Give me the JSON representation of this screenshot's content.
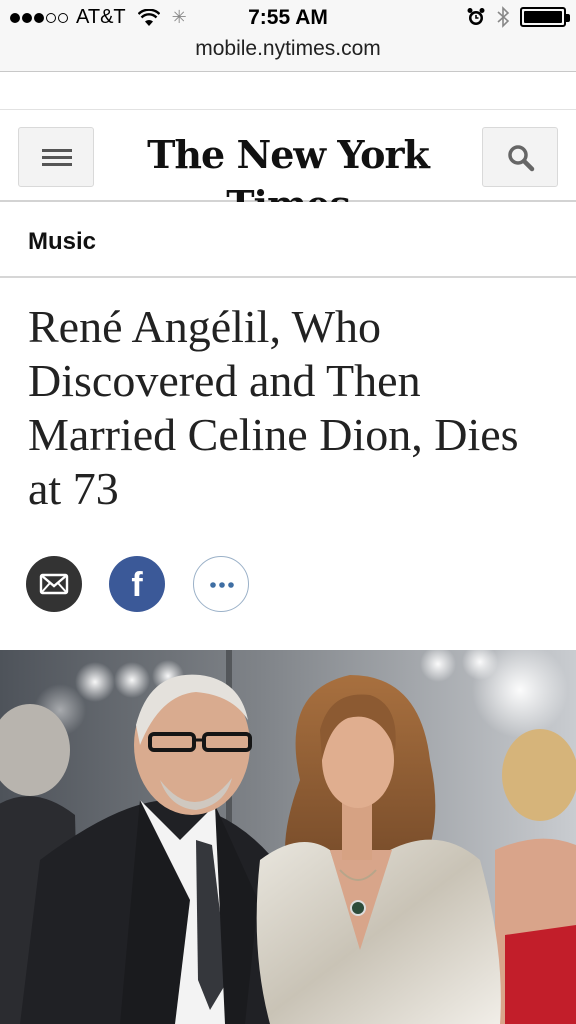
{
  "status_bar": {
    "carrier": "AT&T",
    "time": "7:55 AM",
    "signal_bars_filled": 3,
    "signal_bars_total": 5,
    "battery_level": 1.0
  },
  "browser": {
    "url": "mobile.nytimes.com"
  },
  "header": {
    "logo_text": "The New York Times",
    "menu_icon": "hamburger-menu-icon",
    "search_icon": "search-icon"
  },
  "article": {
    "section": "Music",
    "headline": "René Angélil, Who Discovered and Then Married Celine Dion, Dies at 73",
    "share": {
      "email_icon": "envelope-icon",
      "facebook_letter": "f",
      "more_icon": "ellipsis-icon"
    }
  },
  "colors": {
    "facebook_blue": "#3b5998",
    "email_dark": "#333333",
    "more_border": "#9bb1c8",
    "headline_text": "#222222"
  }
}
